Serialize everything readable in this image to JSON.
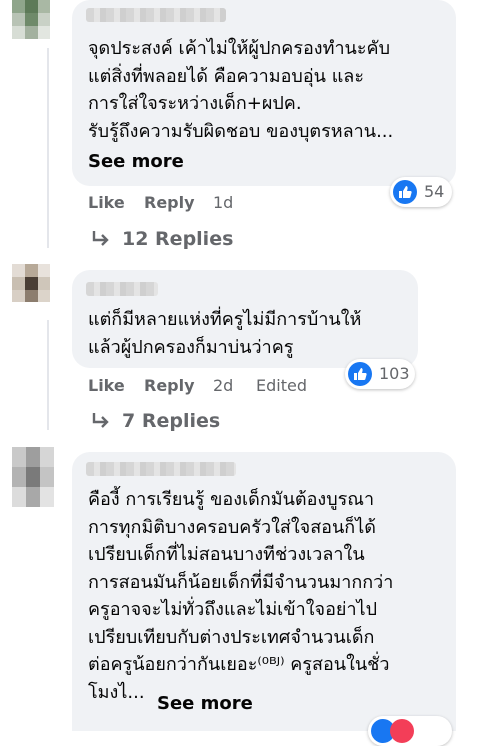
{
  "comments": [
    {
      "text": "จุดประสงค์ เค้าไม่ให้ผู้ปกครองทำนะคับ\nแต่สิ่งที่พลอยได้ คือความอบอุ่น และ\nการใส่ใจระหว่างเด็ก+ผปค.\nรับรู้ถึงความรับผิดชอบ ของบุตรหลาน...",
      "see_more": "See more",
      "like": "Like",
      "reply": "Reply",
      "time": "1d",
      "reaction_count": "54",
      "replies": "12 Replies"
    },
    {
      "text": "แต่ก็มีหลายแห่งที่ครูไม่มีการบ้านให้\nแล้วผู้ปกครองก็มาบ่นว่าครู",
      "like": "Like",
      "reply": "Reply",
      "time": "2d",
      "edited": "Edited",
      "reaction_count": "103",
      "replies": "7 Replies"
    },
    {
      "text": "คืองี้ การเรียนรู้ ของเด็กมันต้องบูรณา\nการทุกมิติบางครอบครัวใส่ใจสอนก็ได้\nเปรียบเด็กที่ไม่สอนบางทีช่วงเวลาใน\nการสอนมันก็น้อยเด็กที่มีจำนวนมากกว่า\nครูอาจจะไม่ทั่วถึงและไม่เข้าใจอย่าไป\nเปรียบเทียบกับต่างประเทศจำนวนเด็ก\nต่อครูน้อยกว่ากันเยอะ⁽⁰ᴮᴶ⁾ ครูสอนในชั่ว\nโมงไ...",
      "see_more": "See more"
    }
  ],
  "colors": {
    "bubble": "#f0f2f5",
    "like_blue": "#1877f2",
    "secondary_text": "#65676b"
  },
  "icons": [
    "thumbs-up-icon",
    "reply-arrow-icon",
    "heart-icon"
  ]
}
